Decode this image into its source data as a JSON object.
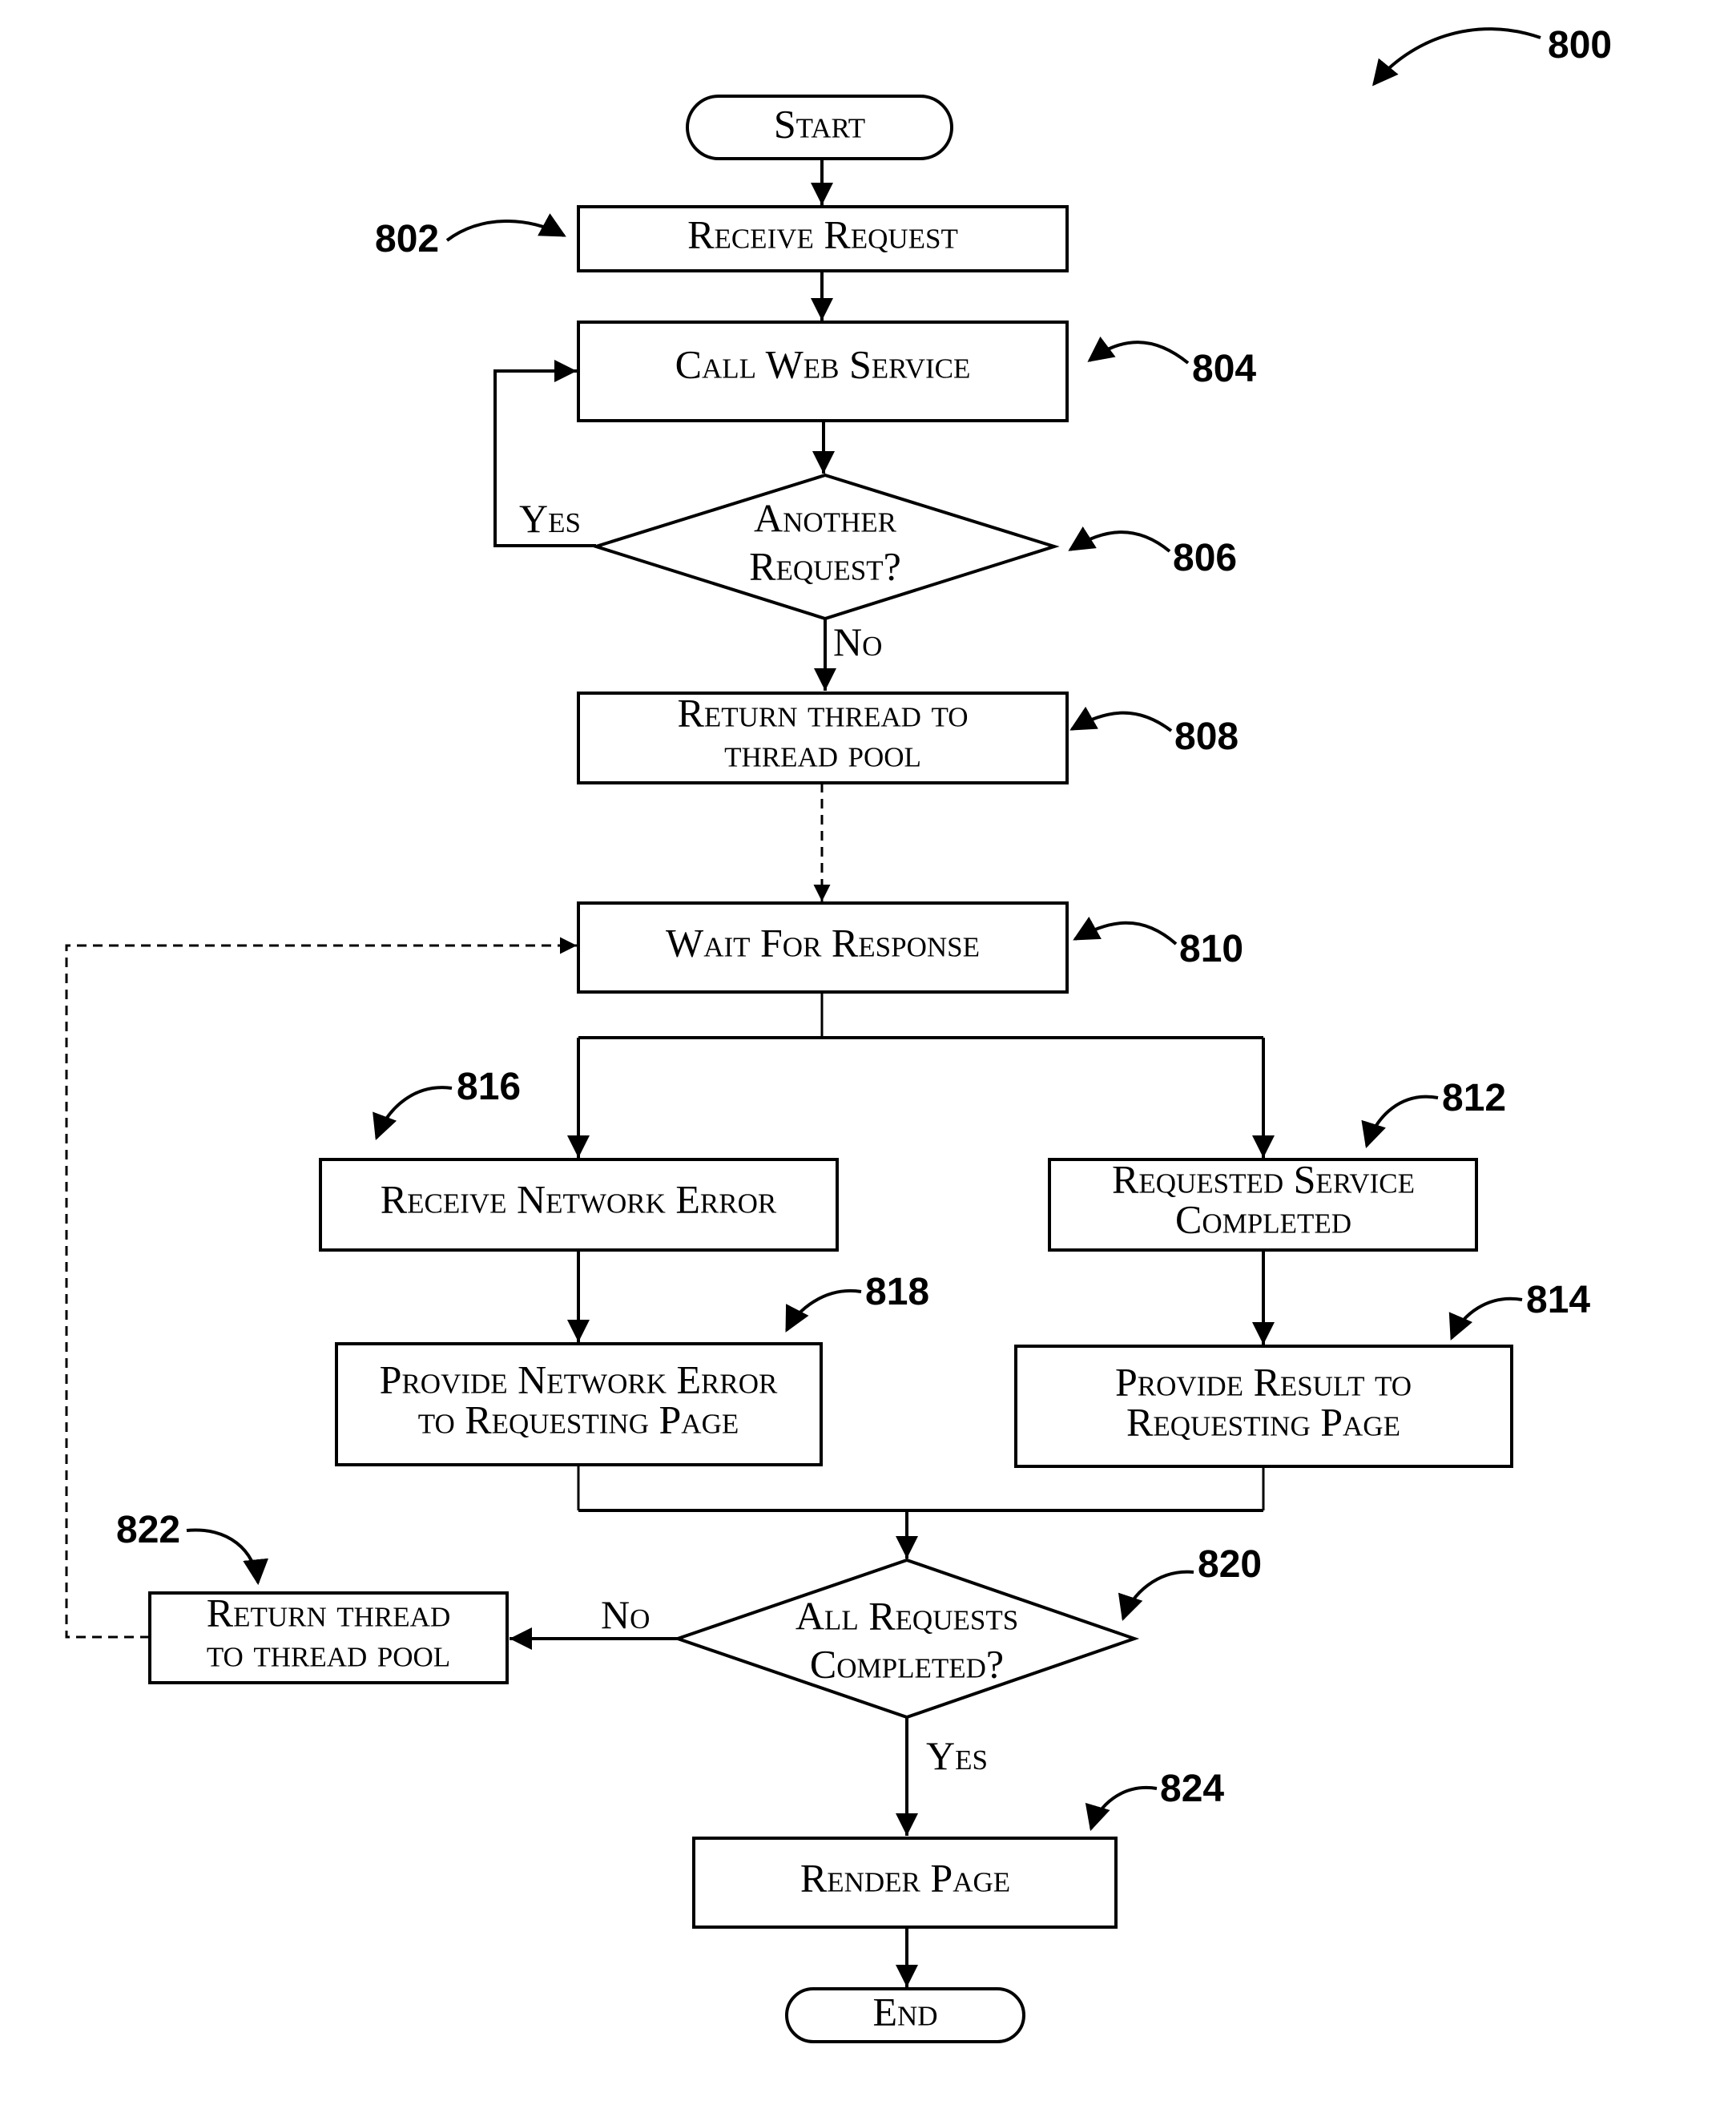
{
  "figure": {
    "reference": "800",
    "nodes": {
      "start": {
        "label": "Start",
        "ref": ""
      },
      "receive_request": {
        "label": "Receive Request",
        "ref": "802"
      },
      "call_web_service": {
        "label": "Call Web Service",
        "ref": "804"
      },
      "another_request": {
        "lines": [
          "Another",
          "Request?"
        ],
        "ref": "806"
      },
      "return_thread_1": {
        "lines": [
          "Return thread to",
          "thread pool"
        ],
        "ref": "808"
      },
      "wait_for_response": {
        "label": "Wait For Response",
        "ref": "810"
      },
      "requested_service_completed": {
        "lines": [
          "Requested Service",
          "Completed"
        ],
        "ref": "812"
      },
      "provide_result": {
        "lines": [
          "Provide Result to",
          "Requesting Page"
        ],
        "ref": "814"
      },
      "receive_network_error": {
        "label": "Receive Network Error",
        "ref": "816"
      },
      "provide_network_error": {
        "lines": [
          "Provide Network Error",
          "to Requesting Page"
        ],
        "ref": "818"
      },
      "all_requests_completed": {
        "lines": [
          "All Requests",
          "Completed?"
        ],
        "ref": "820"
      },
      "return_thread_2": {
        "lines": [
          "Return thread",
          "to thread pool"
        ],
        "ref": "822"
      },
      "render_page": {
        "label": "Render Page",
        "ref": "824"
      },
      "end": {
        "label": "End",
        "ref": ""
      }
    },
    "branch_labels": {
      "another_yes": "Yes",
      "another_no": "No",
      "all_no": "No",
      "all_yes": "Yes"
    }
  }
}
